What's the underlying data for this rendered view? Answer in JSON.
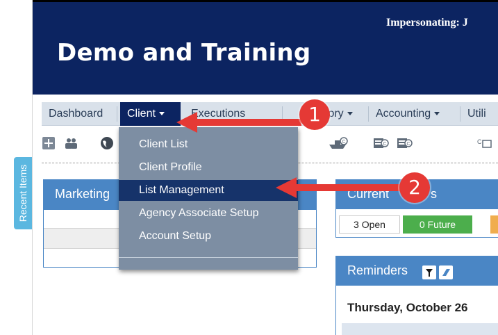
{
  "header": {
    "impersonating": "Impersonating: J",
    "title": "Demo and Training"
  },
  "nav": {
    "items": [
      {
        "label": "Dashboard",
        "dropdown": false
      },
      {
        "label": "Client",
        "dropdown": true,
        "active": true
      },
      {
        "label": "Executions",
        "dropdown": true
      },
      {
        "label": "tory",
        "dropdown": true
      },
      {
        "label": "Accounting",
        "dropdown": true
      },
      {
        "label": "Utili",
        "dropdown": false
      }
    ]
  },
  "toolbar": {
    "icons": [
      "add-icon",
      "people-icon",
      "globe-icon",
      "ship-icon",
      "printer-icon",
      "printer-icon",
      "connector-icon"
    ]
  },
  "recent_items": {
    "label": "Recent Items"
  },
  "dropdown": {
    "items": [
      {
        "label": "Client List"
      },
      {
        "label": "Client Profile"
      },
      {
        "label": "List Management",
        "highlighted": true
      },
      {
        "label": "Agency Associate Setup"
      },
      {
        "label": "Account Setup"
      }
    ]
  },
  "panels": {
    "marketing": {
      "title": "Marketing"
    },
    "current_events": {
      "title_left": "Current",
      "title_right": "s",
      "pills": [
        {
          "label": "3 Open",
          "color": "#ffffff"
        },
        {
          "label": "0 Future",
          "color": "#4cae4c"
        }
      ]
    },
    "reminders": {
      "title": "Reminders",
      "date": "Thursday, October 26"
    }
  },
  "annotations": {
    "arrow_color": "#e53935",
    "callouts": [
      {
        "number": "1"
      },
      {
        "number": "2"
      }
    ]
  }
}
